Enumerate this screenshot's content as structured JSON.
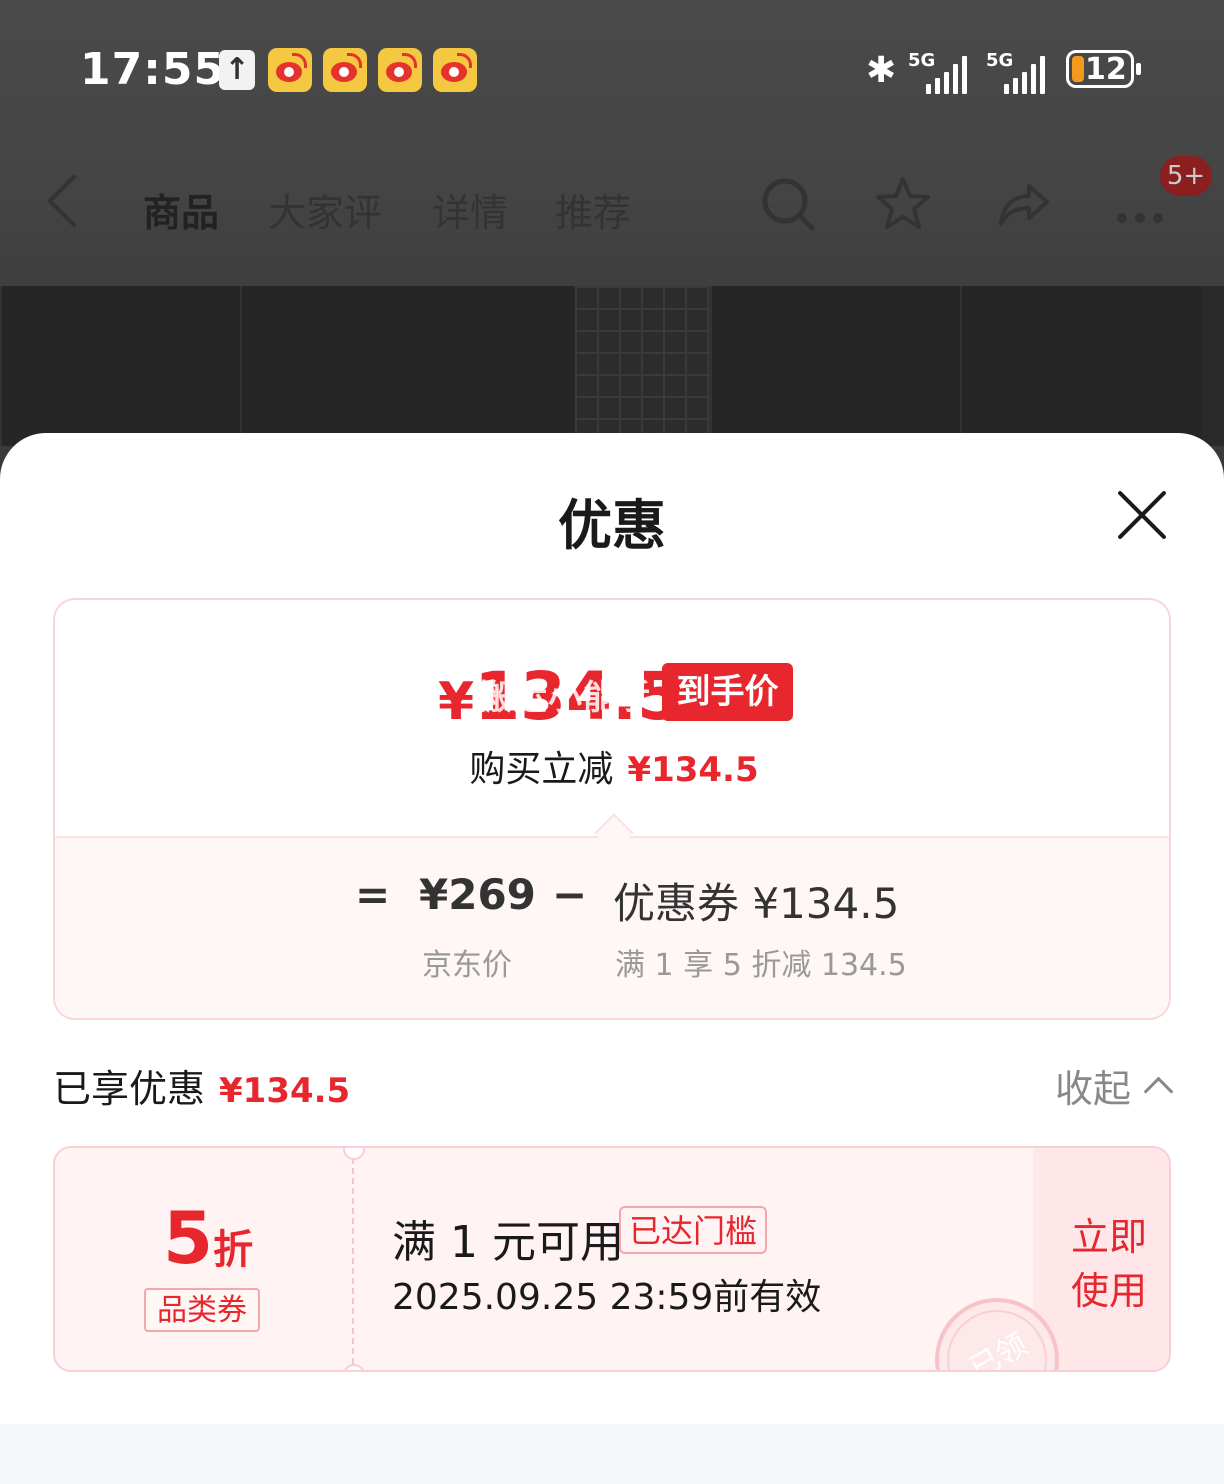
{
  "status_bar": {
    "time": "17:55",
    "signal1": "5G",
    "signal2": "5G",
    "battery": "12"
  },
  "nav": {
    "tabs": [
      {
        "label": "商品",
        "active": true
      },
      {
        "label": "大家评",
        "active": false
      },
      {
        "label": "详情",
        "active": false
      },
      {
        "label": "推荐",
        "active": false
      }
    ],
    "more_badge": "5+"
  },
  "sheet": {
    "title": "优惠",
    "final_price_symbol": "¥",
    "final_price_value": "134.5",
    "final_price_tag": "到手价",
    "watermark": "搬运小能手",
    "reduce_label": "购买立减",
    "reduce_amount": "¥134.5",
    "calc": {
      "equals": "=",
      "base_price": "¥269",
      "base_label": "京东价",
      "minus": "−",
      "coupon_text": "优惠券 ¥134.5",
      "coupon_rule": "满 1 享 5 折减 134.5"
    },
    "enjoyed_label": "已享优惠",
    "enjoyed_amount": "¥134.5",
    "collapse_label": "收起",
    "coupon": {
      "discount_number": "5",
      "discount_unit": "折",
      "category_tag": "品类券",
      "condition": "满 1 元可用",
      "threshold_tag": "已达门槛",
      "validity": "2025.09.25 23:59前有效",
      "use_line1": "立即",
      "use_line2": "使用",
      "stamp": "已领"
    }
  },
  "colors": {
    "accent": "#e8262d",
    "coupon_bg": "#fff3f3",
    "coupon_border": "#f7cfd4"
  }
}
